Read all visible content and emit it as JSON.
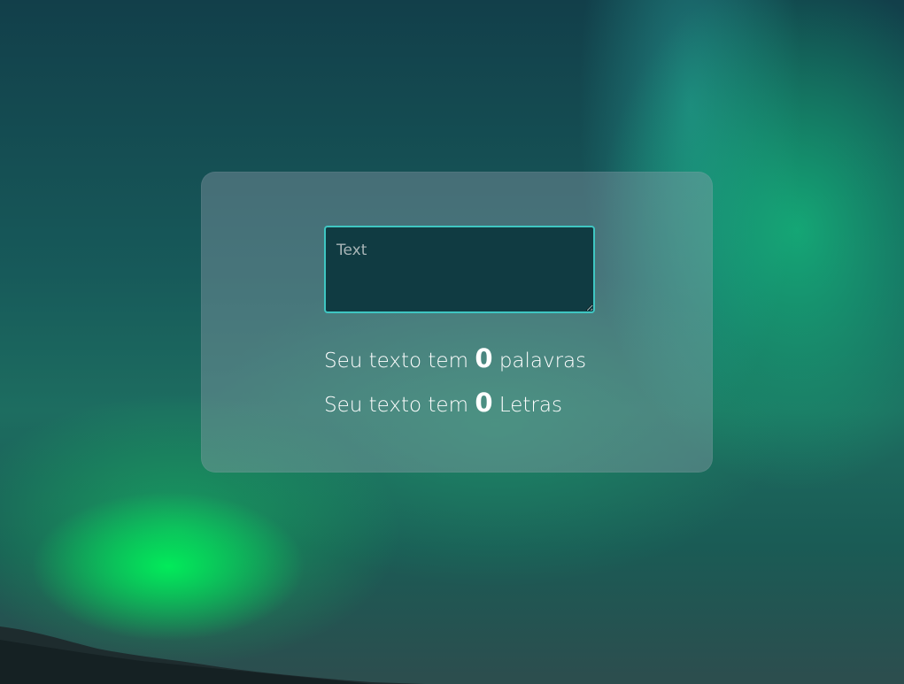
{
  "background": {
    "description_icon": "aurora-borealis-photo"
  },
  "form": {
    "textarea_placeholder": "Text",
    "textarea_value": ""
  },
  "stats": {
    "words": {
      "prefix": "Seu texto tem",
      "count": "0",
      "suffix": "palavras"
    },
    "letters": {
      "prefix": "Seu texto tem",
      "count": "0",
      "suffix": "Letras"
    }
  },
  "colors": {
    "textarea_border": "#3fc6c2",
    "textarea_bg": "#103b42",
    "text": "#ffffff"
  }
}
